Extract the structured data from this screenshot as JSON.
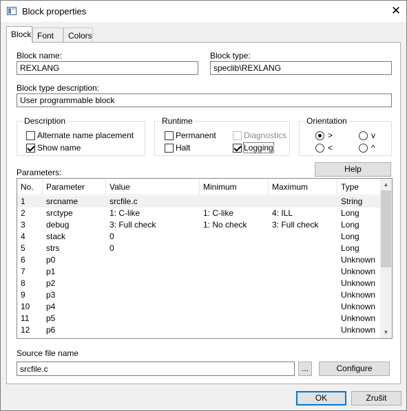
{
  "window": {
    "title": "Block properties"
  },
  "tabs": [
    {
      "label": "Block"
    },
    {
      "label": "Font"
    },
    {
      "label": "Colors"
    }
  ],
  "block": {
    "name_label": "Block name:",
    "name_value": "REXLANG",
    "type_label": "Block type:",
    "type_value": "speclib\\REXLANG",
    "desc_label": "Block type description:",
    "desc_value": "User programmable block"
  },
  "description_group": {
    "title": "Description",
    "alternate_name": {
      "label": "Alternate name placement",
      "checked": false
    },
    "show_name": {
      "label": "Show name",
      "checked": true
    }
  },
  "runtime_group": {
    "title": "Runtime",
    "permanent": {
      "label": "Permanent",
      "checked": false
    },
    "diagnostics": {
      "label": "Diagnostics",
      "checked": false,
      "disabled": true
    },
    "halt": {
      "label": "Halt",
      "checked": false
    },
    "logging": {
      "label": "Logging",
      "checked": true
    }
  },
  "orientation_group": {
    "title": "Orientation",
    "options": [
      {
        "label": ">",
        "checked": true
      },
      {
        "label": "v",
        "checked": false
      },
      {
        "label": "<",
        "checked": false
      },
      {
        "label": "^",
        "checked": false
      }
    ]
  },
  "parameters": {
    "label": "Parameters:",
    "help_label": "Help",
    "columns": [
      "No.",
      "Parameter",
      "Value",
      "Minimum",
      "Maximum",
      "Type"
    ],
    "rows": [
      {
        "no": "1",
        "param": "srcname",
        "value": "srcfile.c",
        "min": "",
        "max": "",
        "type": "String"
      },
      {
        "no": "2",
        "param": "srctype",
        "value": "1: C-like",
        "min": "1: C-like",
        "max": "4: ILL",
        "type": "Long"
      },
      {
        "no": "3",
        "param": "debug",
        "value": "3: Full check",
        "min": "1: No check",
        "max": "3: Full check",
        "type": "Long"
      },
      {
        "no": "4",
        "param": "stack",
        "value": "0",
        "min": "",
        "max": "",
        "type": "Long"
      },
      {
        "no": "5",
        "param": "strs",
        "value": "0",
        "min": "",
        "max": "",
        "type": "Long"
      },
      {
        "no": "6",
        "param": "p0",
        "value": "",
        "min": "",
        "max": "",
        "type": "Unknown"
      },
      {
        "no": "7",
        "param": "p1",
        "value": "",
        "min": "",
        "max": "",
        "type": "Unknown"
      },
      {
        "no": "8",
        "param": "p2",
        "value": "",
        "min": "",
        "max": "",
        "type": "Unknown"
      },
      {
        "no": "9",
        "param": "p3",
        "value": "",
        "min": "",
        "max": "",
        "type": "Unknown"
      },
      {
        "no": "10",
        "param": "p4",
        "value": "",
        "min": "",
        "max": "",
        "type": "Unknown"
      },
      {
        "no": "11",
        "param": "p5",
        "value": "",
        "min": "",
        "max": "",
        "type": "Unknown"
      },
      {
        "no": "12",
        "param": "p6",
        "value": "",
        "min": "",
        "max": "",
        "type": "Unknown"
      }
    ]
  },
  "source": {
    "label": "Source file name",
    "value": "srcfile.c",
    "browse_label": "...",
    "configure_label": "Configure"
  },
  "footer": {
    "ok_label": "OK",
    "cancel_label": "Zrušit"
  },
  "colors": {
    "focus_border": "#0078d7",
    "selected_row": "#f0f0f0",
    "disabled_text": "#8a8a8a"
  },
  "icons": {
    "close": "close-icon",
    "app": "app-window-icon",
    "scroll_up": "scroll-up-arrow-icon",
    "scroll_down": "scroll-down-arrow-icon"
  }
}
